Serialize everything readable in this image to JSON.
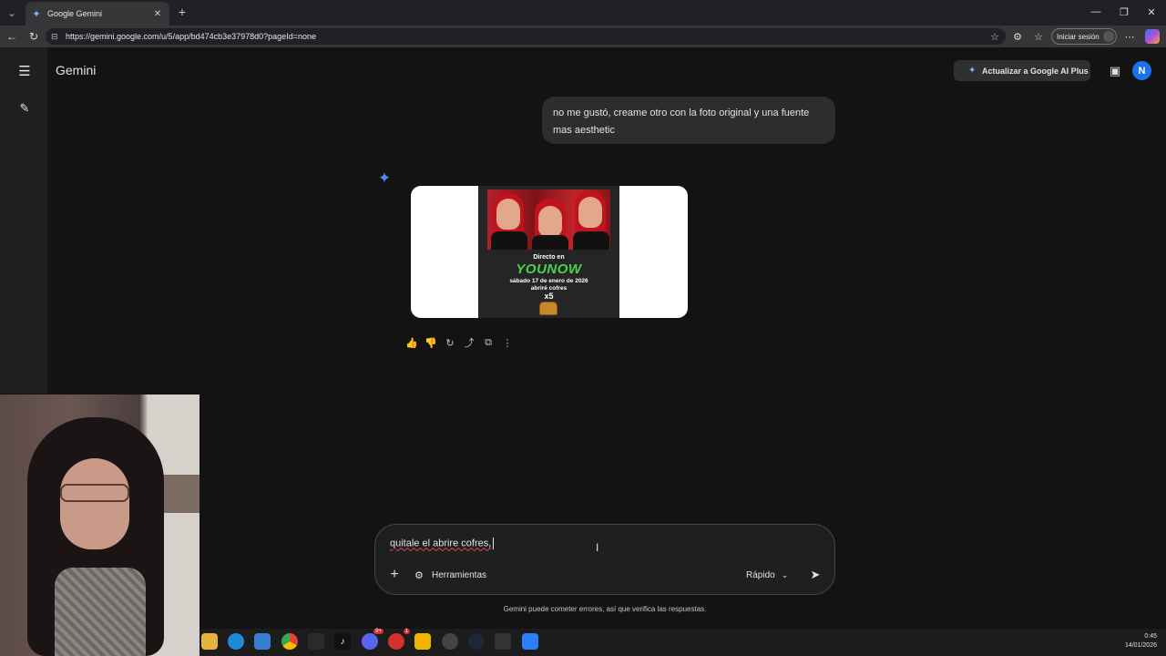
{
  "browser": {
    "tab_title": "Google Gemini",
    "tab_close": "✕",
    "new_tab": "+",
    "tab_menu": "⌄",
    "url": "https://gemini.google.com/u/5/app/bd474cb3e37978d0?pageId=none",
    "sign_in": "Iniciar sesión",
    "window": {
      "minimize": "—",
      "restore": "❐",
      "close": "✕"
    },
    "nav": {
      "back": "←",
      "refresh": "↻"
    },
    "icons": {
      "favorite": "☆",
      "extensions": "⚙",
      "collections": "☆",
      "more": "⋯"
    }
  },
  "app": {
    "brand": "Gemini",
    "menu_icon": "☰",
    "new_chat_icon": "✎",
    "upgrade_label": "Actualizar a Google AI Plus",
    "avatar_letter": "N",
    "gift_icon": "▣"
  },
  "chat": {
    "user_message": "no me gustó, creame otro con la foto original y una fuente mas aesthetic",
    "gemini_spark": "✦",
    "poster": {
      "line1": "Directo en",
      "line2": "YOUNOW",
      "line3": "sábado 17 de enero de 2026",
      "line4": "abriré cofres",
      "line5": "x5"
    },
    "actions": {
      "like": "👍",
      "dislike": "👎",
      "regenerate": "↻",
      "share": "⤴",
      "copy": "⧉",
      "more": "⋮"
    }
  },
  "composer": {
    "input_value": "quitale el abrire cofres,",
    "plus": "+",
    "tools_icon": "⚙",
    "tools_label": "Herramientas",
    "mode_label": "Rápido",
    "mode_chevron": "⌄",
    "send": "➤"
  },
  "disclaimer": "Gemini puede cometer errores, así que verifica las respuestas.",
  "taskbar": {
    "apps": [
      "file-explorer",
      "edge",
      "store",
      "chrome",
      "epic",
      "tiktok",
      "discord",
      "opera",
      "sun-app",
      "screen-app",
      "steam",
      "epic-games",
      "app"
    ],
    "badges": {
      "discord": "9+",
      "opera": "1"
    },
    "time": "0:45",
    "date": "14/01/2026"
  },
  "colors": {
    "background": "#131314",
    "accent": "#1a73e8",
    "younow_green": "#45d64a"
  }
}
